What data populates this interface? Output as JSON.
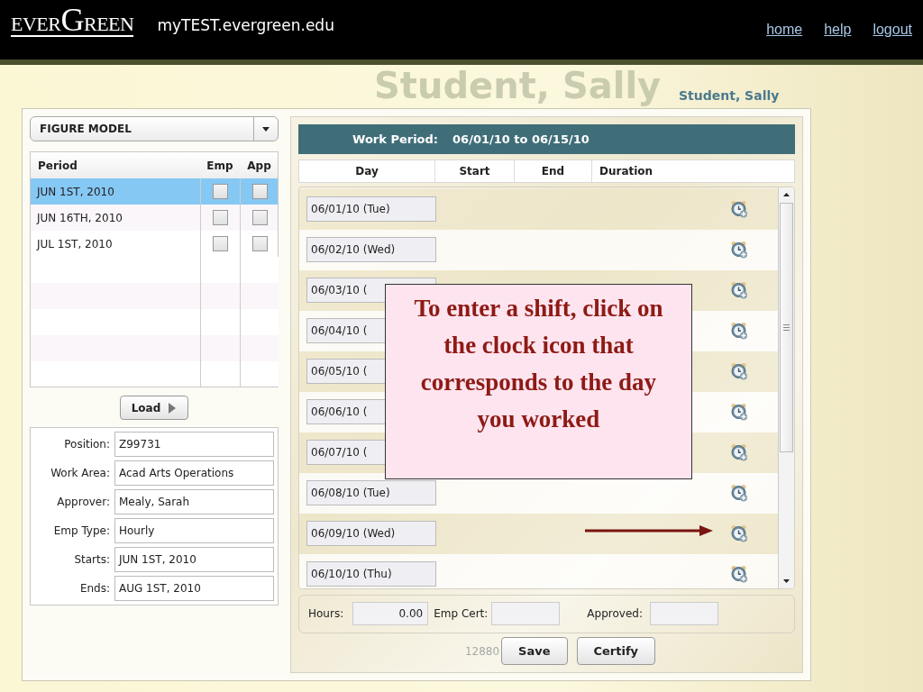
{
  "header": {
    "logo": "EVERGREEN",
    "site": "myTEST.evergreen.edu",
    "links": [
      "home",
      "help",
      "logout"
    ]
  },
  "page_title": "Student, Sally",
  "user_name": "Student, Sally",
  "program_select": {
    "value": "FIGURE MODEL"
  },
  "periods": {
    "columns": [
      "Period",
      "Emp",
      "App"
    ],
    "rows": [
      {
        "period": "JUN 1ST, 2010",
        "emp_checked": false,
        "app_checked": false,
        "selected": true
      },
      {
        "period": "JUN 16TH, 2010",
        "emp_checked": false,
        "app_checked": false,
        "selected": false
      },
      {
        "period": "JUL 1ST, 2010",
        "emp_checked": false,
        "app_checked": false,
        "selected": false
      }
    ]
  },
  "load_button": "Load",
  "details": [
    {
      "label": "Position:",
      "value": "Z99731"
    },
    {
      "label": "Work Area:",
      "value": "Acad Arts Operations"
    },
    {
      "label": "Approver:",
      "value": "Mealy, Sarah"
    },
    {
      "label": "Emp Type:",
      "value": "Hourly"
    },
    {
      "label": "Starts:",
      "value": "JUN 1ST, 2010"
    },
    {
      "label": "Ends:",
      "value": "AUG 1ST, 2010"
    }
  ],
  "work_period": {
    "label": "Work Period:",
    "range": "06/01/10 to 06/15/10"
  },
  "day_columns": [
    "Day",
    "Start",
    "End",
    "Duration"
  ],
  "days": [
    {
      "day": "06/01/10 (Tue)"
    },
    {
      "day": "06/02/10 (Wed)"
    },
    {
      "day": "06/03/10 ("
    },
    {
      "day": "06/04/10 ("
    },
    {
      "day": "06/05/10 ("
    },
    {
      "day": "06/06/10 ("
    },
    {
      "day": "06/07/10 ("
    },
    {
      "day": "06/08/10 (Tue)"
    },
    {
      "day": "06/09/10 (Wed)"
    },
    {
      "day": "06/10/10 (Thu)"
    }
  ],
  "totals": {
    "hours_label": "Hours:",
    "hours": "0.00",
    "emp_cert_label": "Emp Cert:",
    "approved_label": "Approved:"
  },
  "record_id": "12880",
  "buttons": [
    "Save",
    "Certify"
  ],
  "callout": {
    "text": "To enter a shift, click on the clock icon that corresponds to the day you worked"
  }
}
